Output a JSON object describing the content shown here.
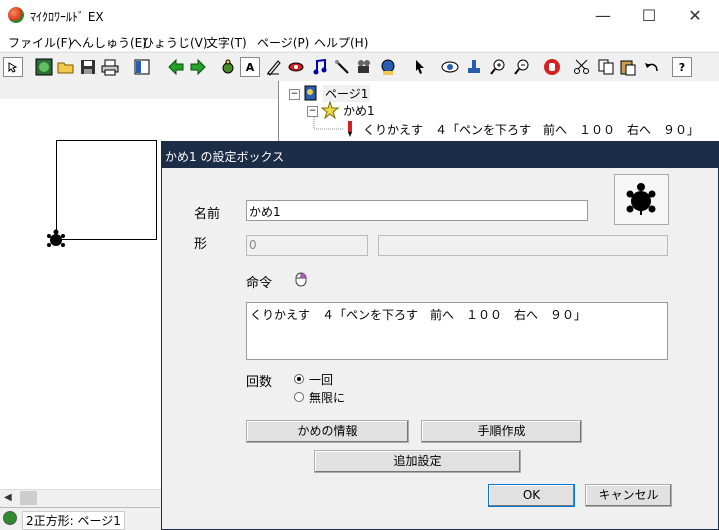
{
  "window": {
    "title": "ﾏｲｸﾛﾜｰﾙﾄﾞ EX",
    "minimize": "—",
    "maximize": "☐",
    "close": "✕"
  },
  "menu": [
    {
      "label": "ファイル(F)"
    },
    {
      "label": "へんしゅう(E)"
    },
    {
      "label": "ひょうじ(V)"
    },
    {
      "label": "文字(T)"
    },
    {
      "label": "ページ(P)"
    },
    {
      "label": "ヘルプ(H)"
    }
  ],
  "toolbar": {
    "text_tool_glyph": "A",
    "help_glyph": "?"
  },
  "tree": {
    "page_label": "ページ1",
    "turtle_label": "かめ1",
    "command_label": "くりかえす　４「ペンを下ろす　前へ　１００　右へ　９０」",
    "expand_glyph": "⊟",
    "collapse_glyph": "−"
  },
  "status": {
    "text": "2正方形: ページ1"
  },
  "dialog": {
    "title": "かめ1 の設定ボックス",
    "name_label": "名前",
    "name_value": "かめ1",
    "shape_label": "形",
    "shape_value": "0",
    "shape_extra": "",
    "command_label": "命令",
    "command_value": "くりかえす　４「ペンを下ろす　前へ　１００　右へ　９０」",
    "count_label": "回数",
    "count_options": [
      "一回",
      "無限に"
    ],
    "count_selected": "一回",
    "info_button": "かめの情報",
    "procedure_button": "手順作成",
    "extra_button": "追加設定",
    "ok_button": "OK",
    "cancel_button": "キャンセル"
  },
  "colors": {
    "dialog_title_bg": "#1c2d47",
    "window_bg": "#f0f0f0"
  }
}
